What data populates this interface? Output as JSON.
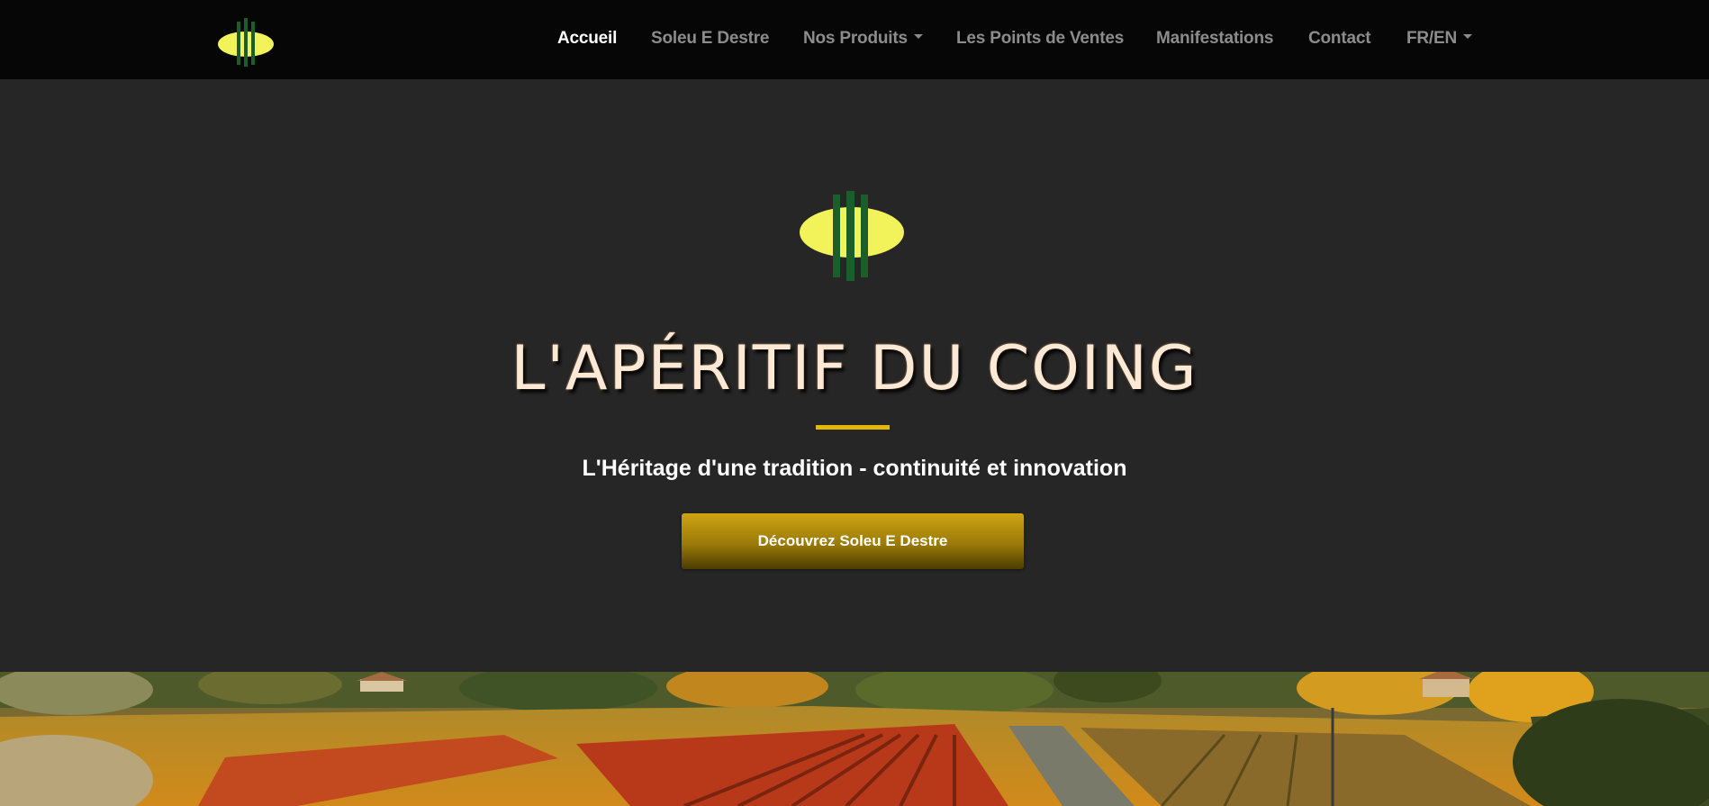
{
  "nav": {
    "items": [
      {
        "label": "Accueil",
        "active": true
      },
      {
        "label": "Soleu E Destre",
        "active": false
      },
      {
        "label": "Nos Produits",
        "active": false,
        "dropdown": true
      },
      {
        "label": "Les Points de Ventes",
        "active": false
      },
      {
        "label": "Manifestations",
        "active": false
      },
      {
        "label": "Contact",
        "active": false
      },
      {
        "label": "FR/EN",
        "active": false,
        "dropdown": true
      }
    ]
  },
  "hero": {
    "title": "L'APÉRITIF DU COING",
    "subtitle": "L'Héritage d'une tradition - continuité et innovation",
    "button_label": "Découvrez Soleu E Destre"
  },
  "colors": {
    "navbar_bg": "#060606",
    "hero_bg": "#262626",
    "accent_gold": "#e5b70b",
    "logo_yellow": "#f2f25a",
    "logo_green": "#1b5e2a",
    "nav_text": "#8c8c8c",
    "nav_active": "#ffffff"
  },
  "icons": {
    "brand_logo": "quince-logo-icon",
    "dropdown": "caret-down-icon"
  }
}
